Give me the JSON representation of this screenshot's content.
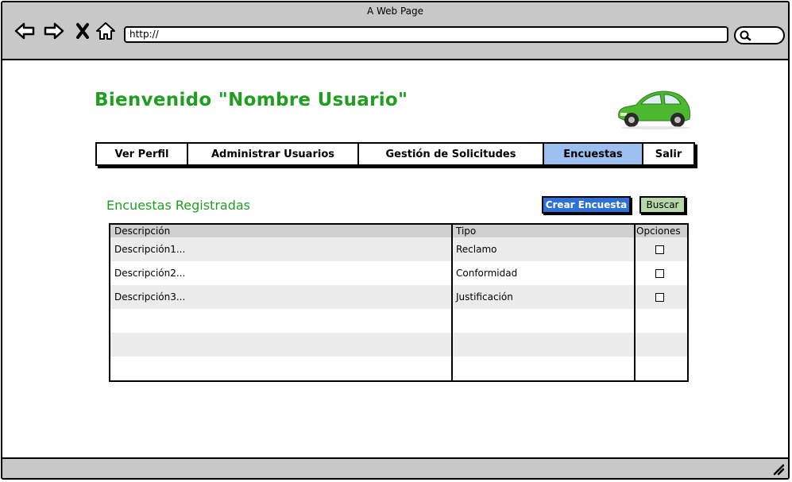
{
  "window": {
    "title": "A Web Page",
    "url": "http://"
  },
  "page": {
    "welcome": "Bienvenido \"Nombre Usuario\"",
    "menu": [
      {
        "label": "Ver Perfil",
        "active": false
      },
      {
        "label": "Administrar Usuarios",
        "active": false
      },
      {
        "label": "Gestión de Solicitudes",
        "active": false
      },
      {
        "label": "Encuestas",
        "active": true
      },
      {
        "label": "Salir",
        "active": false
      }
    ],
    "section_title": "Encuestas Registradas",
    "buttons": {
      "create": "Crear Encuesta",
      "search": "Buscar"
    },
    "table": {
      "headers": [
        "Descripción",
        "Tipo",
        "Opciones"
      ],
      "rows": [
        [
          "Descripción1...",
          "Reclamo"
        ],
        [
          "Descripción2...",
          "Conformidad"
        ],
        [
          "Descripción3...",
          "Justificación"
        ]
      ]
    }
  },
  "colors": {
    "welcome": "#1f9e1f",
    "active_menu": "#9cbff0",
    "create_button": "#2f6fd8",
    "search_button": "#b6d8a8",
    "chrome": "#c8c8c8"
  },
  "icons": [
    "back-arrow-icon",
    "forward-arrow-icon",
    "close-x-icon",
    "home-icon",
    "search-icon",
    "car-icon",
    "resize-grip-icon"
  ]
}
